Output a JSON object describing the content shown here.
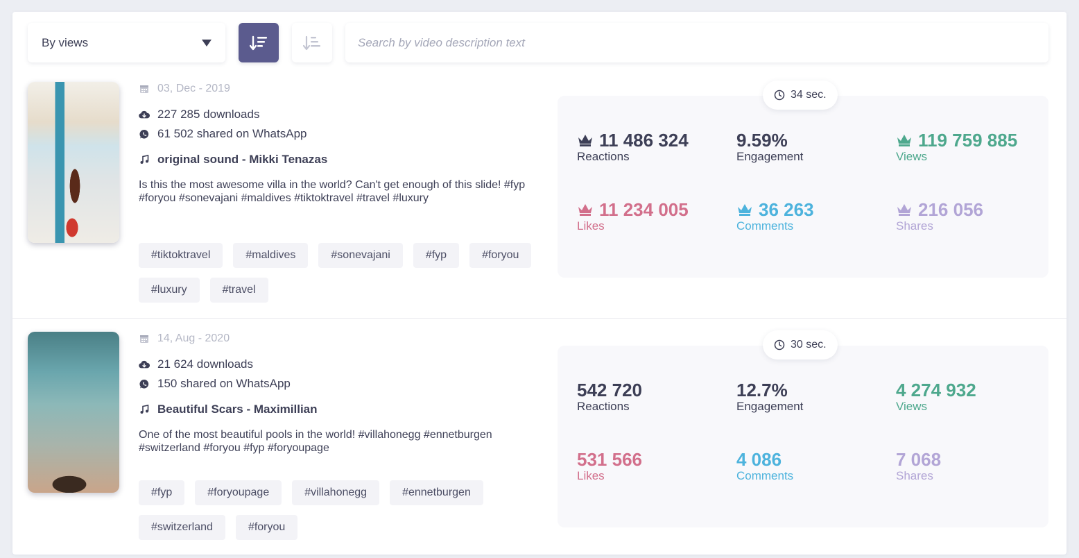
{
  "toolbar": {
    "sort_label": "By views",
    "search_placeholder": "Search by video description text"
  },
  "videos": [
    {
      "thumbnail": "villa-video-thumbnail",
      "date": "03, Dec - 2019",
      "downloads": "227 285 downloads",
      "whatsapp": "61 502 shared on WhatsApp",
      "sound": "original sound - Mikki Tenazas",
      "description": "Is this the most awesome villa in the world? Can't get enough of this slide! #fyp #foryou #sonevajani #maldives #tiktoktravel #travel #luxury",
      "tags": [
        "#tiktoktravel",
        "#maldives",
        "#sonevajani",
        "#fyp",
        "#foryou",
        "#luxury",
        "#travel"
      ],
      "duration": "34 sec.",
      "reactions": "11 486 324",
      "reactions_label": "Reactions",
      "engagement": "9.59%",
      "engagement_label": "Engagement",
      "views": "119 759 885",
      "views_label": "Views",
      "likes": "11 234 005",
      "likes_label": "Likes",
      "comments": "36 263",
      "comments_label": "Comments",
      "shares": "216 056",
      "shares_label": "Shares"
    },
    {
      "thumbnail": "pool-video-thumbnail",
      "date": "14, Aug - 2020",
      "downloads": "21 624 downloads",
      "whatsapp": "150 shared on WhatsApp",
      "sound": "Beautiful Scars - Maximillian",
      "description": "One of the most beautiful pools in the world! #villahonegg #ennetburgen #switzerland #foryou #fyp #foryoupage",
      "tags": [
        "#fyp",
        "#foryoupage",
        "#villahonegg",
        "#ennetburgen",
        "#switzerland",
        "#foryou"
      ],
      "duration": "30 sec.",
      "reactions": "542 720",
      "reactions_label": "Reactions",
      "engagement": "12.7%",
      "engagement_label": "Engagement",
      "views": "4 274 932",
      "views_label": "Views",
      "likes": "531 566",
      "likes_label": "Likes",
      "comments": "4 086",
      "comments_label": "Comments",
      "shares": "7 068",
      "shares_label": "Shares"
    }
  ],
  "colors": {
    "accent": "#5b5b8e",
    "views": "#4ea88d",
    "likes": "#d26f8b",
    "comments": "#4db3dd",
    "shares": "#b2a5d6"
  }
}
